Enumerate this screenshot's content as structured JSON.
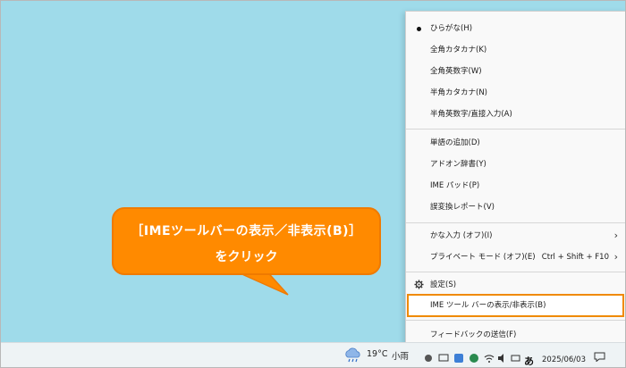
{
  "callout": {
    "line1": "［IMEツールバーの表示／非表示(B)］",
    "line2": "をクリック",
    "color": "#ff8a00"
  },
  "menu": {
    "items": [
      {
        "label": "ひらがな(H)"
      },
      {
        "label": "全角カタカナ(K)"
      },
      {
        "label": "全角英数字(W)"
      },
      {
        "label": "半角カタカナ(N)"
      },
      {
        "label": "半角英数字/直接入力(A)"
      },
      {
        "label": "単語の追加(D)"
      },
      {
        "label": "アドオン辞書(Y)"
      },
      {
        "label": "IME パッド(P)"
      },
      {
        "label": "誤変換レポート(V)"
      },
      {
        "label": "かな入力 (オフ)(I)"
      },
      {
        "label": "プライベート モード (オフ)(E)",
        "shortcut": "Ctrl + Shift + F10"
      },
      {
        "label": "設定(S)"
      },
      {
        "label": "IME ツール バーの表示/非表示(B)"
      },
      {
        "label": "フィードバックの送信(F)"
      }
    ],
    "highlight_color": "#f08a00"
  },
  "taskbar": {
    "temperature": "19°C",
    "condition": "小雨",
    "date": "2025/06/03",
    "ime_mode": "あ"
  }
}
